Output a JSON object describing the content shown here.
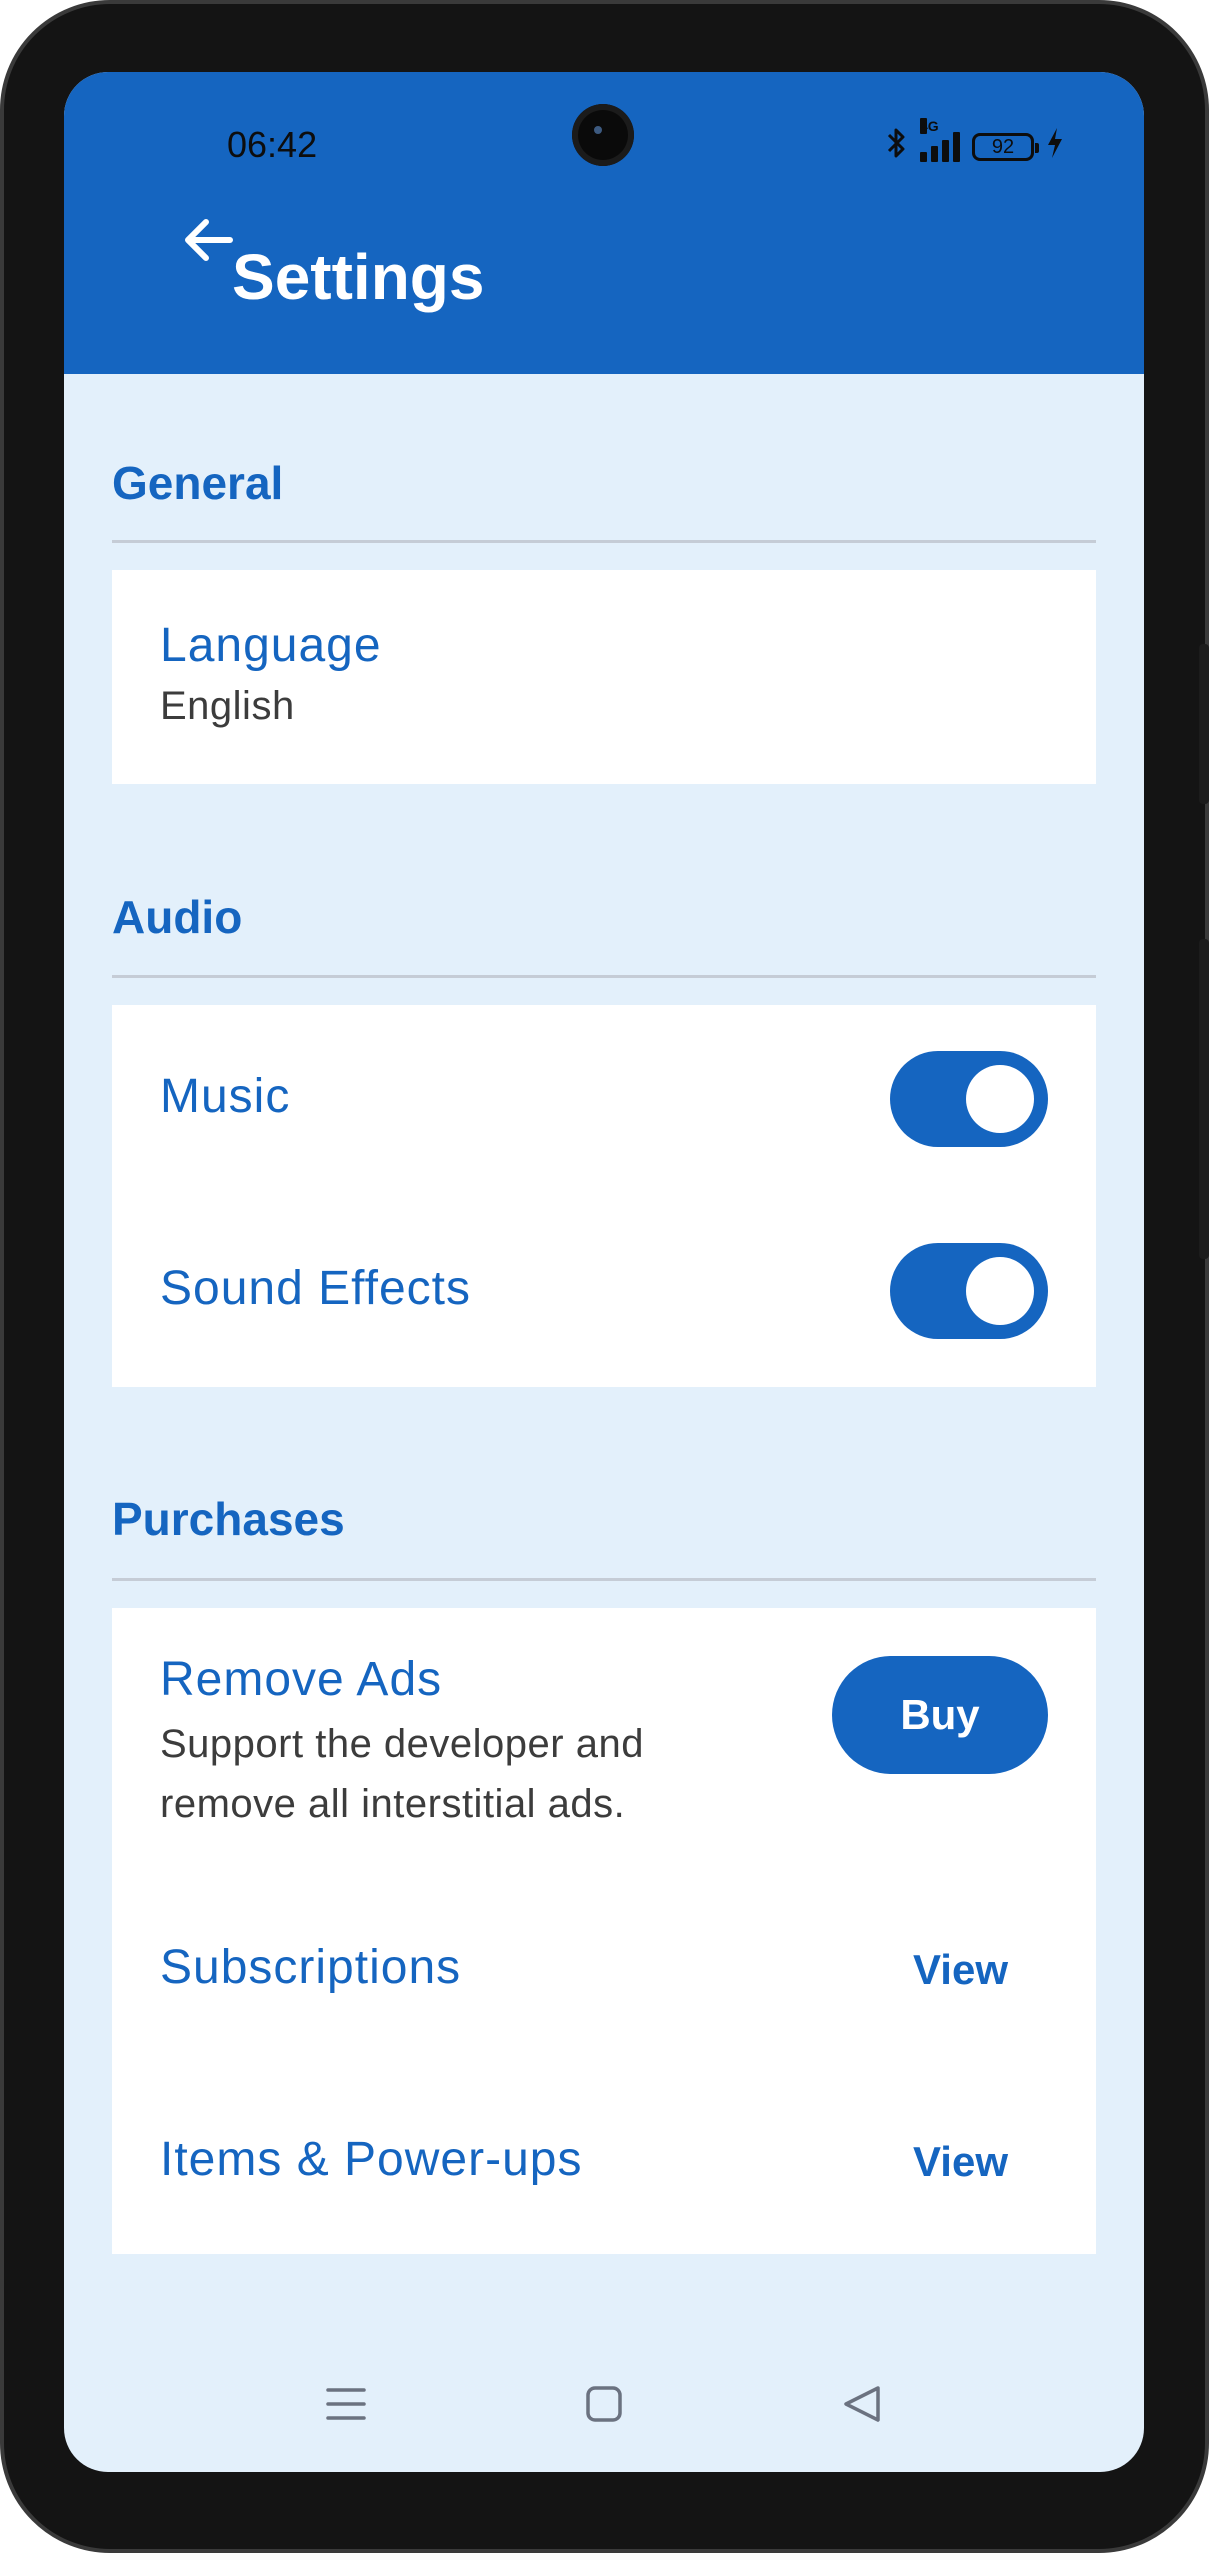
{
  "status_bar": {
    "time": "06:42",
    "network": "4G",
    "battery": "92"
  },
  "app_bar": {
    "title": "Settings",
    "back_icon": "arrow-left-icon"
  },
  "sections": {
    "general": {
      "header": "General",
      "language_title": "Language",
      "language_value": "English"
    },
    "audio": {
      "header": "Audio",
      "music_label": "Music",
      "music_on": true,
      "sfx_label": "Sound Effects",
      "sfx_on": true
    },
    "purchases": {
      "header": "Purchases",
      "remove_ads_title": "Remove Ads",
      "remove_ads_desc_line1": "Support the developer and",
      "remove_ads_desc_line2": "remove all interstitial ads.",
      "buy_label": "Buy",
      "subscriptions_title": "Subscriptions",
      "subscriptions_action": "View",
      "items_title": "Items & Power-ups",
      "items_action": "View"
    }
  },
  "nav_bar": {
    "menu_icon": "menu-icon",
    "home_icon": "home-square-icon",
    "back_icon": "back-triangle-icon"
  },
  "colors": {
    "primary": "#1565c0",
    "background": "#e3f0fb",
    "card": "#ffffff"
  }
}
